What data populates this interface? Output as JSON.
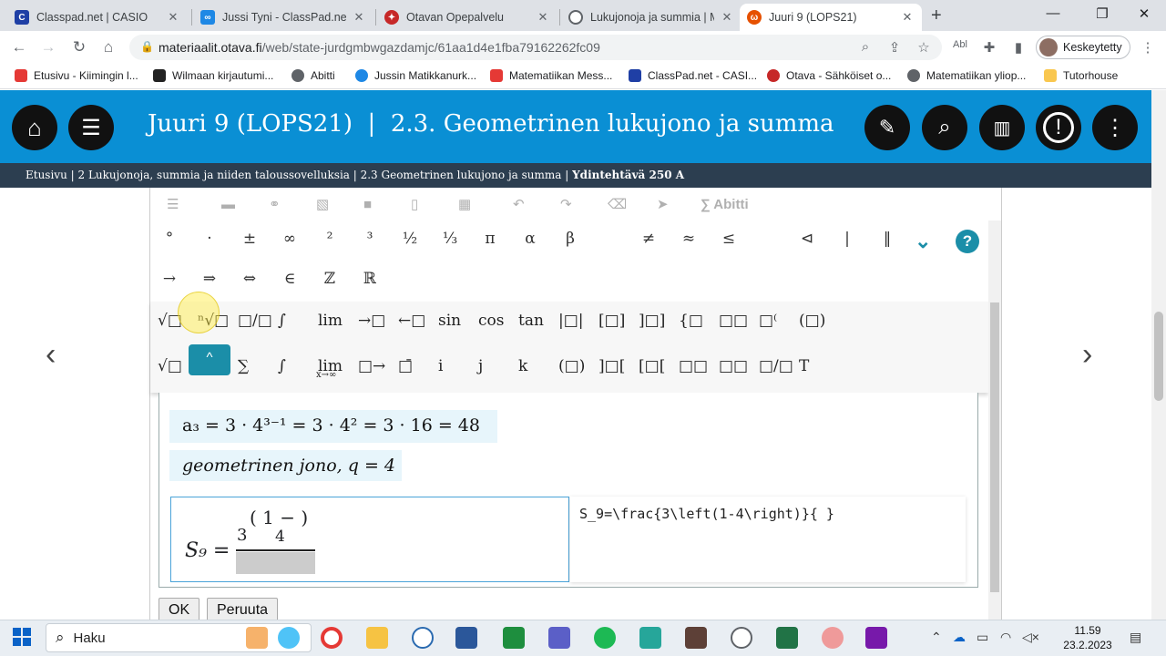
{
  "browser": {
    "tabs": [
      {
        "title": "Classpad.net | CASIO",
        "icon": "classpad-icon",
        "color": "#1f3fa5"
      },
      {
        "title": "Jussi Tyni - ClassPad.net",
        "icon": "link-icon",
        "color": "#1e88e5"
      },
      {
        "title": "Otavan Opepalvelu",
        "icon": "otava-icon",
        "color": "#c62828"
      },
      {
        "title": "Lukujonoja ja summia | M",
        "icon": "globe-icon",
        "color": "#5f6368"
      },
      {
        "title": "Juuri 9 (LOPS21)",
        "icon": "otava-icon",
        "color": "#e65100"
      }
    ],
    "new_tab": "+",
    "url_host": "materiaalit.otava.fi",
    "url_path": "/web/state-jurdgmbwgazdamjc/61aa1d4e1fba79162262fc09",
    "profile_label": "Keskeytetty",
    "bookmarks": [
      {
        "label": "Etusivu - Kiimingin l...",
        "color": "#e53935"
      },
      {
        "label": "Wilmaan kirjautumi...",
        "color": "#222222"
      },
      {
        "label": "Abitti",
        "color": "#5f6368"
      },
      {
        "label": "Jussin Matikkanurk...",
        "color": "#1e88e5"
      },
      {
        "label": "Matematiikan Mess...",
        "color": "#e53935"
      },
      {
        "label": "ClassPad.net - CASI...",
        "color": "#1f3fa5"
      },
      {
        "label": "Otava - Sähköiset o...",
        "color": "#c62828"
      },
      {
        "label": "Matematiikan yliop...",
        "color": "#5f6368"
      },
      {
        "label": "Tutorhouse",
        "color": "#f9c74f"
      }
    ]
  },
  "site": {
    "accent": "#0a8fd4",
    "title_book": "Juuri 9 (LOPS21)",
    "title_sep": "|",
    "title_section": "2.3.  Geometrinen lukujono ja summa",
    "breadcrumb": {
      "home": "Etusivu",
      "chapter": "2 Lukujonoja, summia ja niiden taloussovelluksia",
      "section": "2.3 Geometrinen lukujono ja summa",
      "current": "Ydintehtävä 250 A"
    }
  },
  "editor": {
    "toolbar_abitti": "∑  Abitti",
    "symbols_row1": [
      "°",
      "·",
      "±",
      "∞",
      "²",
      "³",
      "½",
      "⅓",
      "π",
      "α",
      "β",
      "≠",
      "≈",
      "≤",
      "⊲",
      "|",
      "‖"
    ],
    "symbols_row2": [
      "→",
      "⇒",
      "⇔",
      "∈",
      "ℤ",
      "ℝ"
    ],
    "func_row1": [
      "√□",
      "ⁿ√□",
      "□/□",
      "∫",
      "lim",
      "→□",
      "←□",
      "sin",
      "cos",
      "tan",
      "|□|",
      "[□]",
      "]□]",
      "{□",
      "□□",
      "□⁽",
      "(□)"
    ],
    "func_row2": [
      "√□",
      "□",
      "∑",
      "∫",
      "lim",
      "□→",
      "□̄",
      "i",
      "j",
      "k",
      "(□)",
      "]□[",
      "[□[",
      "□□",
      "□□",
      "□/□",
      "T"
    ],
    "lim_sub": "x→∞",
    "tooltip": "^",
    "math_line1": "a₃ = 3 · 4³⁻¹ = 3 · 4² = 3 · 16 = 48",
    "math_line2": "geometrinen jono, q = 4",
    "eq_lhs": "S₉ =",
    "eq_num_coef": "3",
    "eq_paren": "( 1 −  )",
    "eq_num_sub": "4",
    "latex_source": "S_9=\\frac{3\\left(1-4\\right)}{ }",
    "ok_label": "OK",
    "cancel_label": "Peruuta"
  },
  "taskbar": {
    "search_placeholder": "Haku",
    "time": "11.59",
    "date": "23.2.2023"
  }
}
